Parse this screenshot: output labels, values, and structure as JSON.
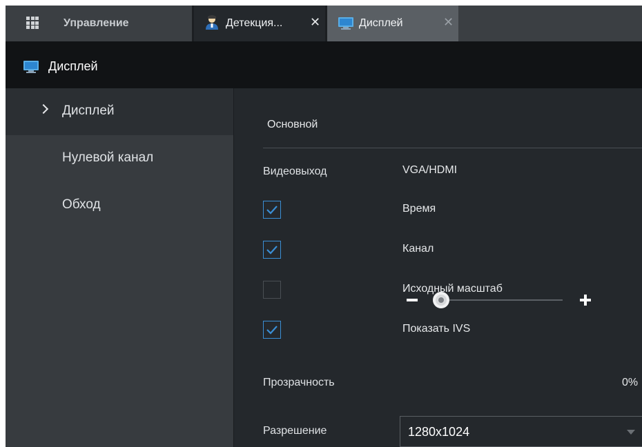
{
  "tabs": {
    "home_label": "Управление",
    "detection_label": "Детекция...",
    "display_label": "Дисплей",
    "close_glyph": "✕"
  },
  "header": {
    "title": "Дисплей"
  },
  "sidebar": {
    "items": [
      {
        "label": "Дисплей",
        "active": true
      },
      {
        "label": "Нулевой канал",
        "active": false
      },
      {
        "label": "Обход",
        "active": false
      }
    ]
  },
  "main": {
    "section_title": "Основной",
    "video_output": {
      "label": "Видеовыход",
      "value": "VGA/HDMI"
    },
    "checkboxes": [
      {
        "label": "Время",
        "checked": true
      },
      {
        "label": "Канал",
        "checked": true
      },
      {
        "label": "Исходный масштаб",
        "checked": false
      },
      {
        "label": "Показать IVS",
        "checked": true
      }
    ],
    "transparency": {
      "label": "Прозрачность",
      "value_text": "0%",
      "value": 0
    },
    "resolution": {
      "label": "Разрешение",
      "value": "1280x1024"
    }
  },
  "colors": {
    "accent": "#3a8fd6",
    "tabbar": "#3b3f43",
    "header": "#111315",
    "sidebar": "#373b3f",
    "content": "#24282c"
  },
  "icons": [
    "grid-icon",
    "person-icon",
    "monitor-icon",
    "close-icon",
    "chevron-right-icon",
    "checkmark-icon",
    "minus-icon",
    "plus-icon",
    "caret-down-icon"
  ]
}
